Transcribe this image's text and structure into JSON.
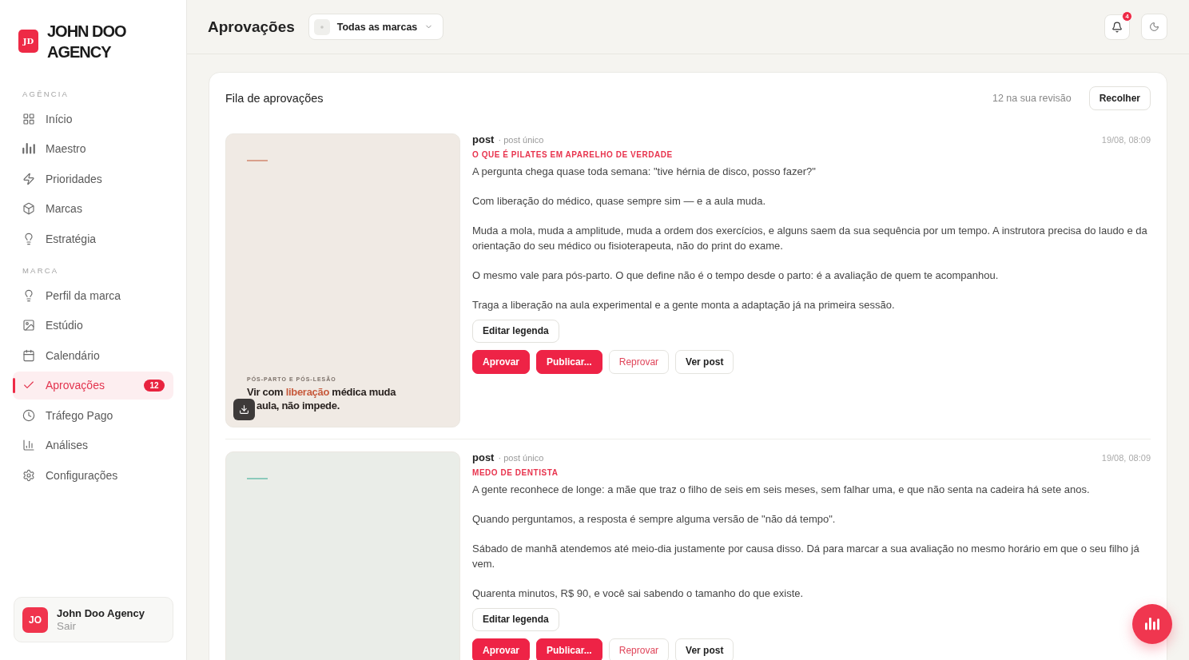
{
  "sidebar": {
    "logo_initials": "JD",
    "brand_name": "JOHN DOO AGENCY",
    "sections": [
      {
        "label": "AGÊNCIA",
        "items": [
          {
            "label": "Início",
            "selected": false
          },
          {
            "label": "Maestro",
            "selected": false
          },
          {
            "label": "Prioridades",
            "selected": false
          },
          {
            "label": "Marcas",
            "selected": false
          },
          {
            "label": "Estratégia",
            "selected": false
          }
        ]
      },
      {
        "label": "MARCA",
        "items": [
          {
            "label": "Perfil da marca",
            "selected": false
          },
          {
            "label": "Estúdio",
            "selected": false
          },
          {
            "label": "Calendário",
            "selected": false
          },
          {
            "label": "Aprovações",
            "selected": true,
            "badge": "12"
          },
          {
            "label": "Tráfego Pago",
            "selected": false
          },
          {
            "label": "Análises",
            "selected": false
          },
          {
            "label": "Configurações",
            "selected": false
          }
        ]
      }
    ],
    "account": {
      "initials": "JO",
      "name": "John Doo Agency",
      "action": "Sair"
    }
  },
  "header": {
    "title": "Aprovações",
    "brand_filter": "Todas as marcas",
    "notifications": "4"
  },
  "queue": {
    "title": "Fila de aprovações",
    "count": "12 na sua revisão",
    "collapse_button": "Recolher",
    "posts": [
      {
        "type": "post",
        "format": "· post único",
        "date": "19/08, 08:09",
        "title": "O QUE É PILATES EM APARELHO DE VERDADE",
        "paragraphs": [
          "A pergunta chega quase toda semana: \"tive hérnia de disco, posso fazer?\"",
          "Com liberação do médico, quase sempre sim — e a aula muda.",
          "Muda a mola, muda a amplitude, muda a ordem dos exercícios, e alguns saem da sua sequência por um tempo. A instrutora precisa do laudo e da orientação do seu médico ou fisioterapeuta, não do print do exame.",
          "O mesmo vale para pós-parto. O que define não é o tempo desde o parto: é a avaliação de quem te acompanhou.",
          "Traga a liberação na aula experimental e a gente monta a adaptação já na primeira sessão."
        ],
        "edit_button": "Editar legenda",
        "actions": [
          {
            "label": "Aprovar",
            "kind": "approve"
          },
          {
            "label": "Publicar...",
            "kind": "publish"
          },
          {
            "label": "Reprovar",
            "kind": "reject"
          },
          {
            "label": "Ver post",
            "kind": "view"
          }
        ],
        "preview": {
          "color": "#d9a08c",
          "tag": "PÓS-PARTO E PÓS-LESÃO",
          "headline": [
            "Vir com **liberação** médica muda",
            "aula, não impede."
          ]
        }
      },
      {
        "type": "post",
        "format": "· post único",
        "date": "19/08, 08:09",
        "title": "MEDO DE DENTISTA",
        "paragraphs": [
          "A gente reconhece de longe: a mãe que traz o filho de seis em seis meses, sem falhar uma, e que não senta na cadeira há sete anos.",
          "Quando perguntamos, a resposta é sempre alguma versão de \"não dá tempo\".",
          "Sábado de manhã atendemos até meio-dia justamente por causa disso. Dá para marcar a sua avaliação no mesmo horário em que o seu filho já vem.",
          "Quarenta minutos, R$ 90, e você sai sabendo o tamanho do que existe."
        ],
        "edit_button": "Editar legenda",
        "actions": [
          {
            "label": "Aprovar",
            "kind": "approve"
          },
          {
            "label": "Publicar...",
            "kind": "publish"
          },
          {
            "label": "Reprovar",
            "kind": "reject"
          },
          {
            "label": "Ver post",
            "kind": "view"
          }
        ],
        "preview": {
          "color": "#8ccabb"
        }
      }
    ]
  }
}
